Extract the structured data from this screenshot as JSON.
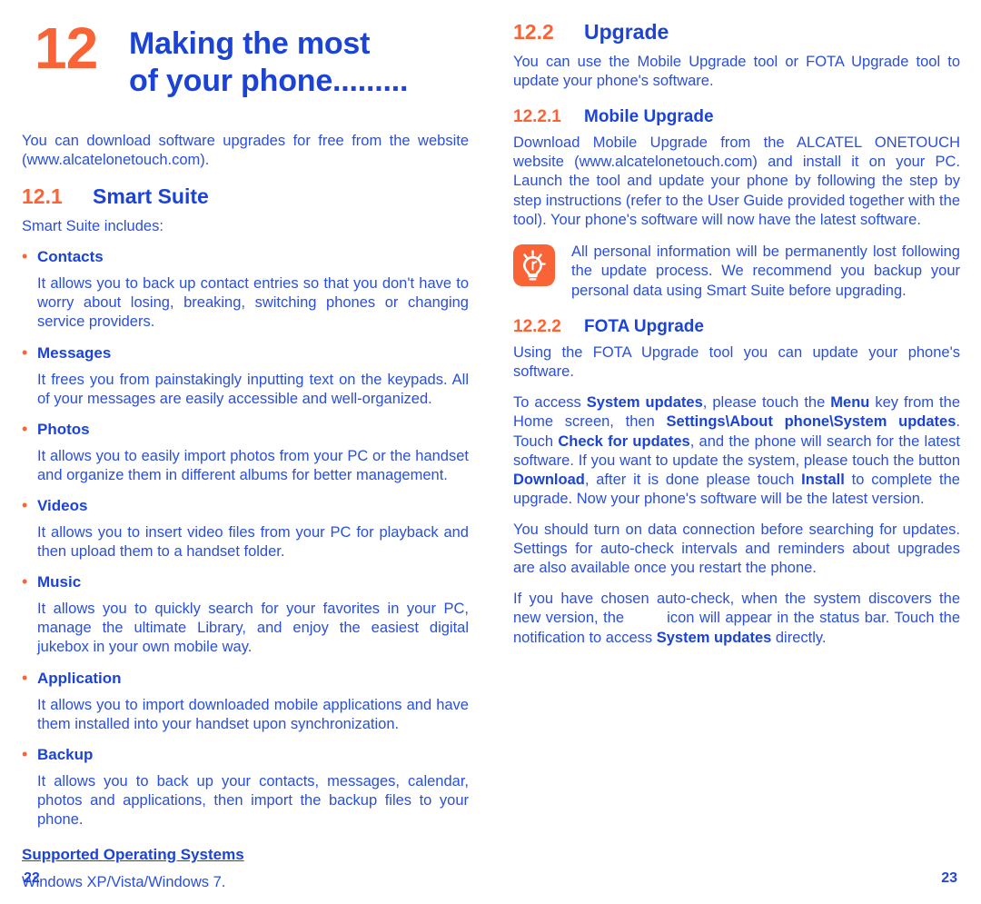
{
  "chapter": {
    "number": "12",
    "title_line1": "Making the most",
    "title_line2": "of your phone.........",
    "intro": "You can download software upgrades for free from the website (www.alcatelonetouch.com)."
  },
  "colors": {
    "orange": "#f96335",
    "blue_heading": "#1b44d6",
    "blue_body": "#2a4fdb"
  },
  "sections": {
    "smart_suite": {
      "number": "12.1",
      "title": "Smart Suite",
      "lead": "Smart Suite includes:",
      "items": [
        {
          "label": "Contacts",
          "body": "It allows you to back up contact entries so that you don't have to worry about losing, breaking, switching phones or changing service providers."
        },
        {
          "label": "Messages",
          "body": "It frees you from painstakingly inputting text on the keypads. All of your messages are easily accessible and well-organized."
        },
        {
          "label": "Photos",
          "body": "It allows you to easily import photos from your PC or the handset and organize them in different albums for better management."
        },
        {
          "label": "Videos",
          "body": "It allows you to insert video files from your PC for playback and then upload them to a handset folder."
        },
        {
          "label": "Music",
          "body": "It allows you to quickly search for your favorites in your PC, manage the ultimate Library, and enjoy the easiest digital jukebox in your own mobile way."
        },
        {
          "label": "Application",
          "body": "It allows you to import downloaded mobile applications and have them installed into your handset upon synchronization."
        },
        {
          "label": "Backup",
          "body": "It allows you to back up your contacts, messages, calendar, photos and applications, then import the backup files to your phone."
        }
      ],
      "supported_os_heading": "Supported Operating Systems",
      "supported_os_value": "Windows XP/Vista/Windows 7."
    },
    "upgrade": {
      "number": "12.2",
      "title": "Upgrade",
      "intro": "You can use the Mobile Upgrade tool or FOTA Upgrade tool to update your phone's software."
    },
    "mobile_upgrade": {
      "number": "12.2.1",
      "title": "Mobile Upgrade",
      "body": "Download Mobile Upgrade from the ALCATEL ONETOUCH website (www.alcatelonetouch.com) and install it on your PC. Launch the tool and update your phone by following the step by step instructions (refer to the User Guide provided together with the tool). Your phone's software will now have the latest software.",
      "tip_icon": "lightbulb-tip-icon",
      "tip": "All personal information will be permanently lost following the update process. We recommend you backup your personal data using Smart Suite before upgrading."
    },
    "fota_upgrade": {
      "number": "12.2.2",
      "title": "FOTA Upgrade",
      "para1": "Using the FOTA Upgrade tool you can update your phone's software.",
      "para2_parts": {
        "t1": "To access ",
        "b1": "System updates",
        "t2": ", please touch the ",
        "b2": "Menu",
        "t3": " key from the Home screen, then ",
        "b3": "Settings\\About phone\\System updates",
        "t4": ". Touch ",
        "b4": "Check for updates",
        "t5": ", and the phone will search for the latest software. If you want to update the system, please touch the button ",
        "b5": "Download",
        "t6": ", after it is done please touch ",
        "b6": "Install",
        "t7": " to complete the upgrade. Now your phone's software will be the latest version."
      },
      "para3": "You should turn on data connection before searching for updates. Settings for auto-check intervals and reminders about upgrades are also available once you restart the phone.",
      "para4_parts": {
        "t1": "If you have chosen auto-check, when the system discovers the new version, the ",
        "t2": " icon will appear in the status bar. Touch the notification to access ",
        "b1": "System updates",
        "t3": " directly."
      }
    }
  },
  "folio": {
    "left": "22",
    "right": "23"
  }
}
